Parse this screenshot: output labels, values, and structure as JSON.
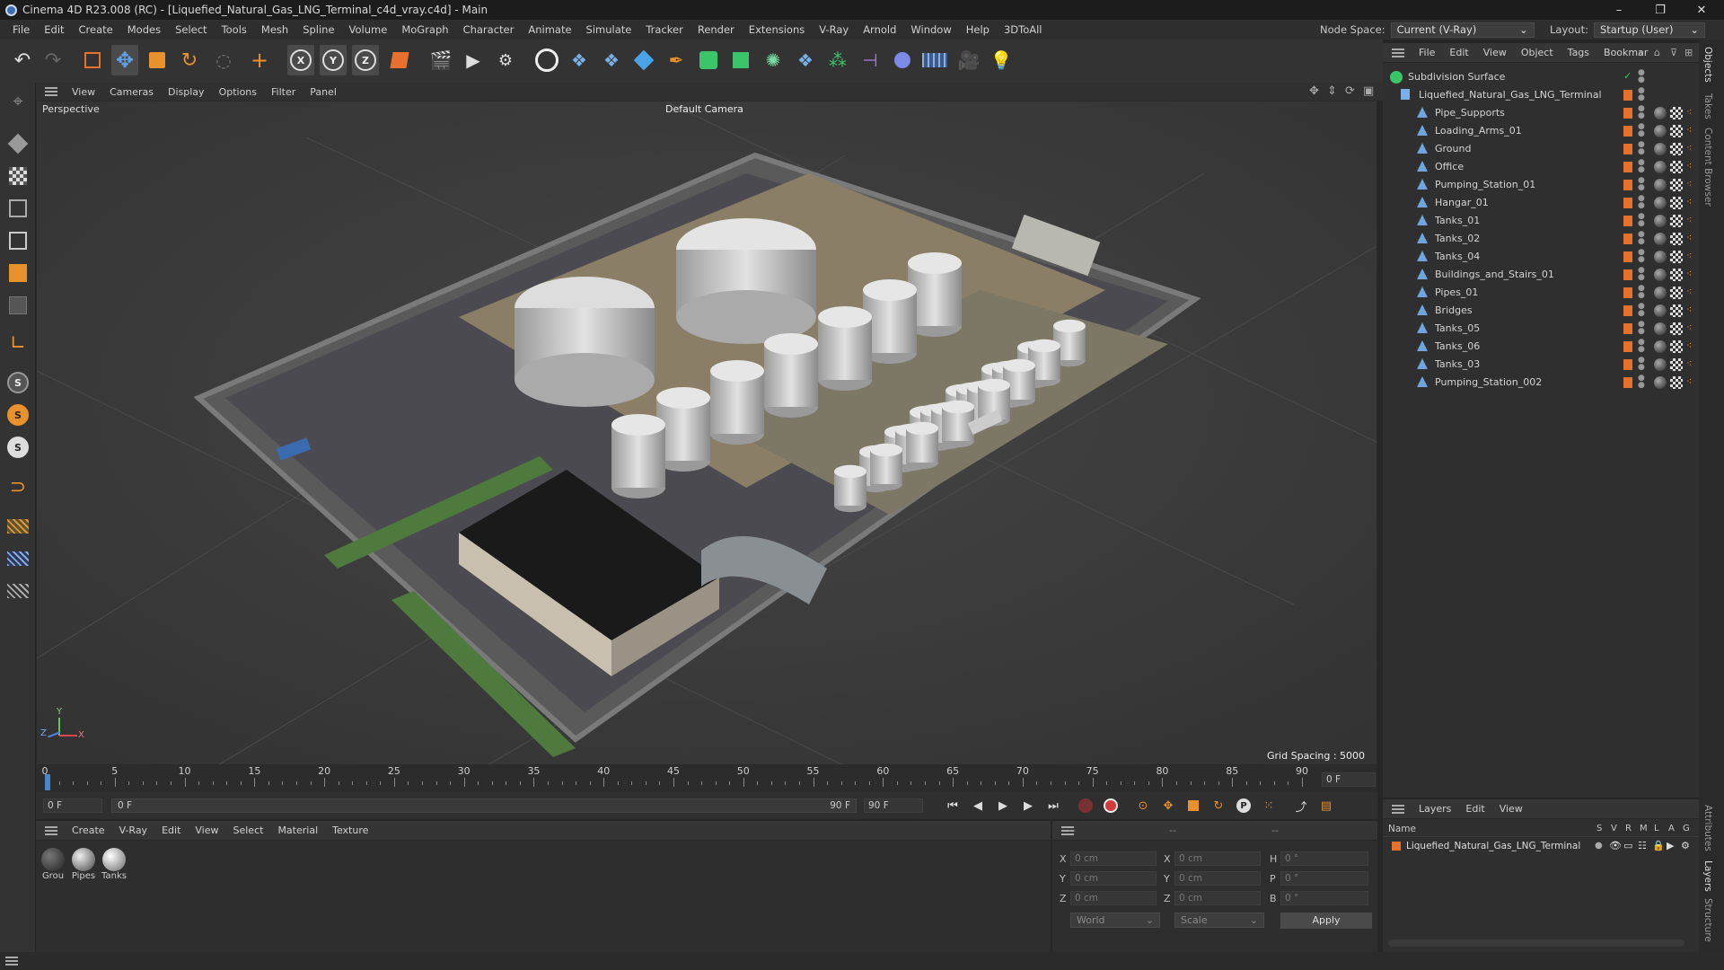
{
  "window": {
    "title": "Cinema 4D R23.008 (RC) - [Liquefied_Natural_Gas_LNG_Terminal_c4d_vray.c4d] - Main"
  },
  "menubar": {
    "items": [
      "File",
      "Edit",
      "Create",
      "Modes",
      "Select",
      "Tools",
      "Mesh",
      "Spline",
      "Volume",
      "MoGraph",
      "Character",
      "Animate",
      "Simulate",
      "Tracker",
      "Render",
      "Extensions",
      "V-Ray",
      "Arnold",
      "Window",
      "Help",
      "3DToAll"
    ],
    "node_space_label": "Node Space:",
    "node_space_value": "Current (V-Ray)",
    "layout_label": "Layout:",
    "layout_value": "Startup (User)"
  },
  "viewport": {
    "menu": [
      "View",
      "Cameras",
      "Display",
      "Options",
      "Filter",
      "Panel"
    ],
    "view_name": "Perspective",
    "camera": "Default Camera",
    "grid_spacing": "Grid Spacing : 5000 cm",
    "axis_x": "X",
    "axis_y": "Y",
    "axis_z": "Z"
  },
  "timeline": {
    "ticks": [
      "0",
      "5",
      "10",
      "15",
      "20",
      "25",
      "30",
      "35",
      "40",
      "45",
      "50",
      "55",
      "60",
      "65",
      "70",
      "75",
      "80",
      "85",
      "90"
    ],
    "current_frame_right": "0 F",
    "start_field": "0 F",
    "range_start": "0 F",
    "range_end": "90 F",
    "end_field": "90 F"
  },
  "materials": {
    "menu": [
      "Create",
      "V-Ray",
      "Edit",
      "View",
      "Select",
      "Material",
      "Texture"
    ],
    "items": [
      {
        "label": "Grou",
        "color": "#3a3a3a"
      },
      {
        "label": "Pipes",
        "color": "#8a8a8a"
      },
      {
        "label": "Tanks",
        "color": "#b5b5b5"
      }
    ]
  },
  "coords": {
    "header_a": "--",
    "header_b": "--",
    "header_c": "--",
    "rows": [
      {
        "a": "X",
        "av": "0 cm",
        "b": "X",
        "bv": "0 cm",
        "c": "H",
        "cv": "0 °"
      },
      {
        "a": "Y",
        "av": "0 cm",
        "b": "Y",
        "bv": "0 cm",
        "c": "P",
        "cv": "0 °"
      },
      {
        "a": "Z",
        "av": "0 cm",
        "b": "Z",
        "bv": "0 cm",
        "c": "B",
        "cv": "0 °"
      }
    ],
    "world": "World",
    "scale": "Scale",
    "apply": "Apply"
  },
  "objects": {
    "menu": [
      "File",
      "Edit",
      "View",
      "Object",
      "Tags",
      "Bookmar"
    ],
    "root": "Subdivision Surface",
    "group": "Liquefied_Natural_Gas_LNG_Terminal",
    "children": [
      "Pipe_Supports",
      "Loading_Arms_01",
      "Ground",
      "Office",
      "Pumping_Station_01",
      "Hangar_01",
      "Tanks_01",
      "Tanks_02",
      "Tanks_04",
      "Buildings_and_Stairs_01",
      "Pipes_01",
      "Bridges",
      "Tanks_05",
      "Tanks_06",
      "Tanks_03",
      "Pumping_Station_002"
    ]
  },
  "layers": {
    "menu": [
      "Layers",
      "Edit",
      "View"
    ],
    "name_col": "Name",
    "flags": [
      "S",
      "V",
      "R",
      "M",
      "L",
      "A",
      "G"
    ],
    "items": [
      "Liquefied_Natural_Gas_LNG_Terminal"
    ]
  },
  "side_tabs": [
    "Objects",
    "Takes",
    "Content Browser",
    "Attributes",
    "Layers",
    "Structure"
  ],
  "colors": {
    "accent_orange": "#e8712d",
    "selection_blue": "#4a86c5",
    "keyframe_red": "#d13b3b"
  }
}
